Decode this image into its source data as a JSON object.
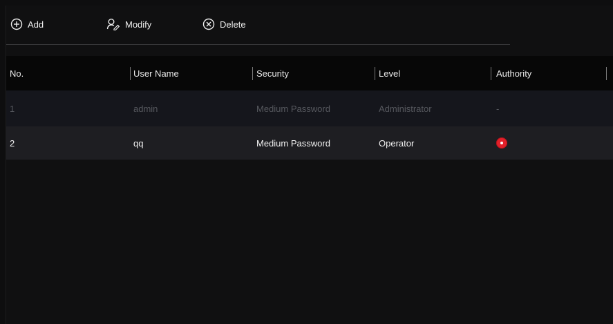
{
  "toolbar": {
    "add_label": "Add",
    "modify_label": "Modify",
    "delete_label": "Delete"
  },
  "table": {
    "columns": [
      "No.",
      "User Name",
      "Security",
      "Level",
      "Authority"
    ],
    "rows": [
      {
        "no": "1",
        "user_name": "admin",
        "security": "Medium Password",
        "level": "Administrator",
        "authority": "-",
        "enabled": false
      },
      {
        "no": "2",
        "user_name": "qq",
        "security": "Medium Password",
        "level": "Operator",
        "authority_icon": "record-dot-icon",
        "enabled": true
      }
    ]
  },
  "colors": {
    "background": "#101011",
    "header_bg": "#070707",
    "disabled_text": "#56585e",
    "accent_red": "#e2202a"
  }
}
